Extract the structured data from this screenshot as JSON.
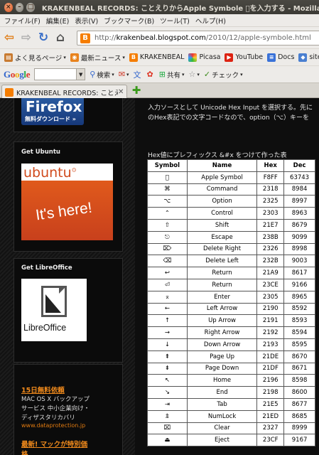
{
  "window": {
    "title": "KRAKENBEAL RECORDS: ことえりからApple Symbole を入力する - Mozilla Firefox"
  },
  "menu": [
    "ファイル(F)",
    "編集(E)",
    "表示(V)",
    "ブックマーク(B)",
    "ツール(T)",
    "ヘルプ(H)"
  ],
  "nav": {
    "url_prefix": "http://",
    "url_host": "krakenbeal.blogspot.com",
    "url_path": "/2010/12/apple-symbole.html"
  },
  "bookmarks": [
    "よく見るページ",
    "最新ニュース",
    "KRAKENBEAL",
    "Picasa",
    "YouTube",
    "Docs",
    "site"
  ],
  "google_toolbar": {
    "logo": "Google",
    "search_label": "検索",
    "share_label": "共有",
    "check_label": "チェック"
  },
  "tab": {
    "label": "KRAKENBEAL RECORDS: ことえり..."
  },
  "sidebar": {
    "firefox": {
      "line1": "Firefox",
      "line2": "無料ダウンロード »"
    },
    "ubuntu": {
      "title": "Get Ubuntu",
      "logo": "ubuntu",
      "tagline": "It's here!"
    },
    "libre": {
      "title": "Get LibreOffice",
      "logo": "LibreOffice"
    },
    "ads": [
      {
        "title": "15日無料依頼",
        "lines": [
          "MAC OS X バックアップ",
          "サービス 中小企業向け・",
          "ディザスタリカバリ"
        ],
        "url": "www.dataprotection.jp"
      },
      {
        "title": "最新! マックが特別価",
        "lines": [
          "格"
        ],
        "url": ""
      }
    ]
  },
  "main": {
    "intro_line1": "入力ソースとして Unicode Hex Input を選択する。先に",
    "intro_line2": "のHex表記での文字コードなので、option（⌥）キーを",
    "caption": "Hex値にプレフィックス &#x をつけて作った表",
    "table": {
      "headers": [
        "Symbol",
        "Name",
        "Hex",
        "Dec"
      ],
      "rows": [
        [
          "",
          "Apple Symbol",
          "F8FF",
          "63743"
        ],
        [
          "⌘",
          "Command",
          "2318",
          "8984"
        ],
        [
          "⌥",
          "Option",
          "2325",
          "8997"
        ],
        [
          "⌃",
          "Control",
          "2303",
          "8963"
        ],
        [
          "⇧",
          "Shift",
          "21E7",
          "8679"
        ],
        [
          "⎋",
          "Escape",
          "238B",
          "9099"
        ],
        [
          "⌦",
          "Delete Right",
          "2326",
          "8998"
        ],
        [
          "⌫",
          "Delete Left",
          "232B",
          "9003"
        ],
        [
          "↩",
          "Return",
          "21A9",
          "8617"
        ],
        [
          "⏎",
          "Return",
          "23CE",
          "9166"
        ],
        [
          "⌅",
          "Enter",
          "2305",
          "8965"
        ],
        [
          "←",
          "Left Arrow",
          "2190",
          "8592"
        ],
        [
          "↑",
          "Up Arrow",
          "2191",
          "8593"
        ],
        [
          "→",
          "Right Arrow",
          "2192",
          "8594"
        ],
        [
          "↓",
          "Down Arrow",
          "2193",
          "8595"
        ],
        [
          "⇞",
          "Page Up",
          "21DE",
          "8670"
        ],
        [
          "⇟",
          "Page Down",
          "21DF",
          "8671"
        ],
        [
          "↖",
          "Home",
          "2196",
          "8598"
        ],
        [
          "↘",
          "End",
          "2198",
          "8600"
        ],
        [
          "⇥",
          "Tab",
          "21E5",
          "8677"
        ],
        [
          "⇭",
          "NumLock",
          "21ED",
          "8685"
        ],
        [
          "⌧",
          "Clear",
          "2327",
          "8999"
        ],
        [
          "⏏",
          "Eject",
          "23CF",
          "9167"
        ]
      ]
    }
  }
}
